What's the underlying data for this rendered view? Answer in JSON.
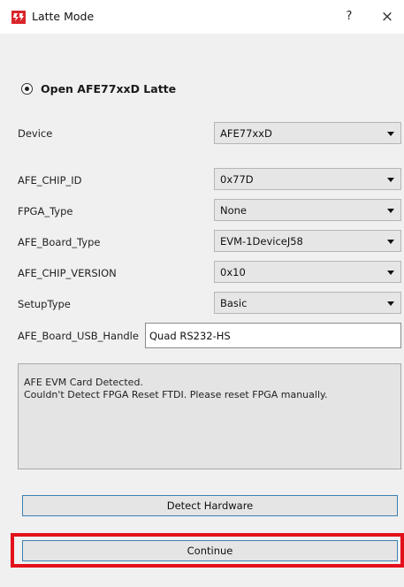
{
  "window": {
    "title": "Latte Mode",
    "help_label": "?",
    "close_label": "×",
    "app_icon": "latte-logo-icon",
    "accent_color": "#e3101a"
  },
  "radio": {
    "label": "Open AFE77xxD Latte",
    "selected": true
  },
  "fields": [
    {
      "label": "Device",
      "value": "AFE77xxD"
    },
    {
      "label": "AFE_CHIP_ID",
      "value": "0x77D"
    },
    {
      "label": "FPGA_Type",
      "value": "None"
    },
    {
      "label": "AFE_Board_Type",
      "value": "EVM-1DeviceJ58"
    },
    {
      "label": "AFE_CHIP_VERSION",
      "value": "0x10"
    },
    {
      "label": "SetupType",
      "value": "Basic"
    }
  ],
  "usb_handle": {
    "label": "AFE_Board_USB_Handle",
    "value": "Quad RS232-HS"
  },
  "status": {
    "lines": [
      "AFE EVM Card Detected.",
      "Couldn't Detect FPGA Reset FTDI. Please reset FPGA manually."
    ]
  },
  "buttons": {
    "detect_label": "Detect Hardware",
    "continue_label": "Continue"
  }
}
